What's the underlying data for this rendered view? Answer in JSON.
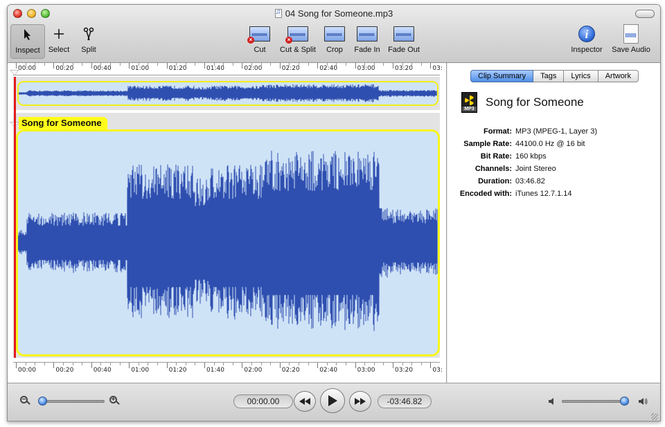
{
  "window": {
    "title": "04 Song for Someone.mp3"
  },
  "toolbar": {
    "inspect": "Inspect",
    "select": "Select",
    "split": "Split",
    "cut": "Cut",
    "cut_split": "Cut & Split",
    "crop": "Crop",
    "fade_in": "Fade In",
    "fade_out": "Fade Out",
    "inspector": "Inspector",
    "save_audio": "Save Audio"
  },
  "timeline": {
    "labels": [
      "00:00",
      "00:20",
      "00:40",
      "01:00",
      "01:20",
      "01:40",
      "02:00",
      "02:20",
      "02:40",
      "03:00",
      "03:20",
      "03:"
    ]
  },
  "clip": {
    "label": "Song for Someone"
  },
  "inspector": {
    "tabs": [
      "Clip Summary",
      "Tags",
      "Lyrics",
      "Artwork"
    ],
    "active_tab": "Clip Summary",
    "clip_name": "Song for Someone",
    "file_icon": "MP3",
    "properties": [
      {
        "key": "Format:",
        "value": "MP3 (MPEG-1, Layer 3)"
      },
      {
        "key": "Sample Rate:",
        "value": "44100.0 Hz @ 16 bit"
      },
      {
        "key": "Bit Rate:",
        "value": "160 kbps"
      },
      {
        "key": "Channels:",
        "value": "Joint Stereo"
      },
      {
        "key": "Duration:",
        "value": "03:46.82"
      },
      {
        "key": "Encoded with:",
        "value": "iTunes 12.7.1.14"
      }
    ]
  },
  "transport": {
    "current_time": "00:00.00",
    "remaining_time": "-03:46.82",
    "zoom_level": 0.0,
    "volume_level": 1.0
  },
  "colors": {
    "waveform": "#2f4fb0",
    "clip_border": "#f7f51a",
    "clip_fill": "#cfe3f7",
    "playhead": "#e21b1b",
    "accent": "#4f8fe6"
  }
}
